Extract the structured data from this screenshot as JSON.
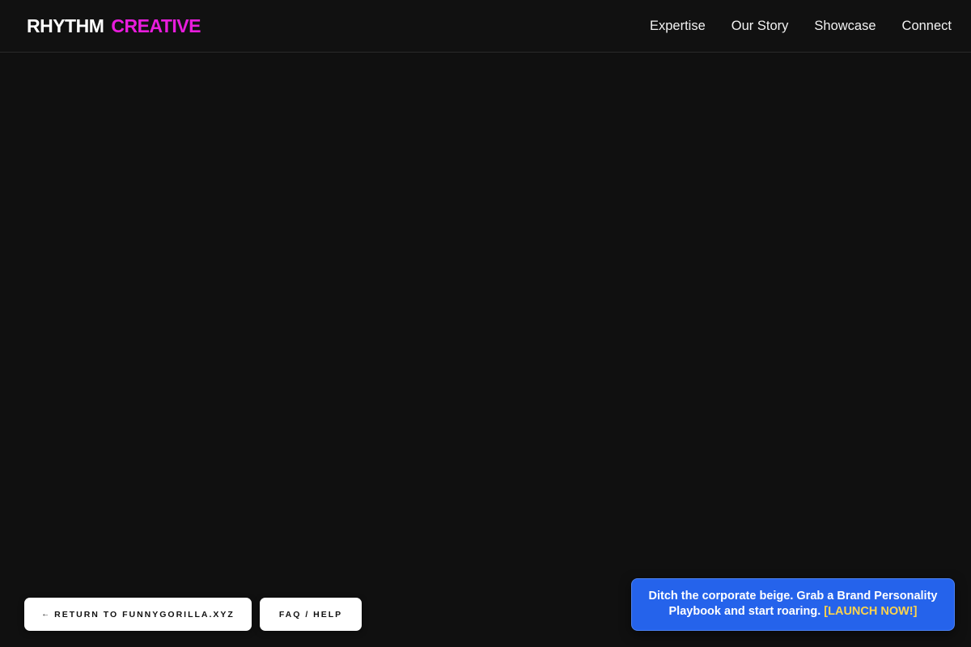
{
  "header": {
    "logo_primary": "RHYTHM",
    "logo_accent": "CREATIVE",
    "nav": [
      {
        "label": "Expertise"
      },
      {
        "label": "Our Story"
      },
      {
        "label": "Showcase"
      },
      {
        "label": "Connect"
      }
    ]
  },
  "footer_buttons": {
    "return_arrow": "←",
    "return_label": "RETURN TO FUNNYGORILLA.XYZ",
    "faq_label": "FAQ / HELP"
  },
  "promo": {
    "text": "Ditch the corporate beige. Grab a Brand Personality Playbook and start roaring.",
    "cta": "[LAUNCH NOW!]"
  },
  "colors": {
    "background": "#101010",
    "logo_accent": "#e81cdc",
    "promo_bg": "#2563eb",
    "promo_cta": "#fcd34d"
  }
}
